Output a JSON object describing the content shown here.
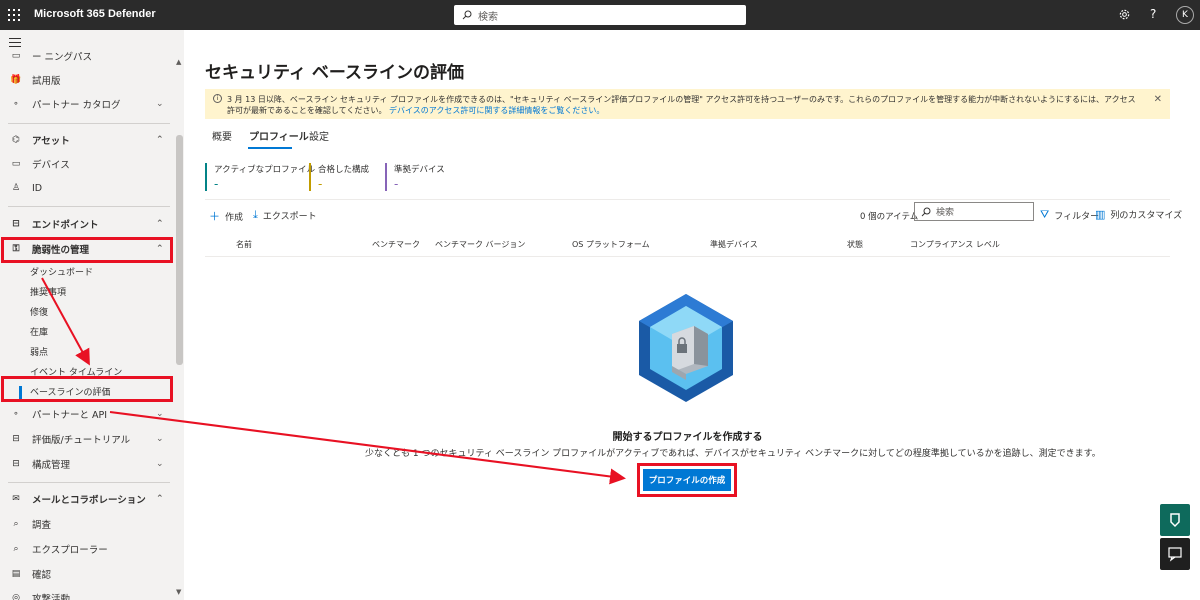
{
  "app": {
    "title": "Microsoft 365 Defender",
    "search_placeholder": "検索",
    "help": "?",
    "avatar": "K"
  },
  "sidebar": {
    "items": [
      {
        "label": "ー ニングパス",
        "icon": "learning-icon"
      },
      {
        "label": "試用版",
        "icon": "trial-icon"
      },
      {
        "label": "パートナー カタログ",
        "icon": "partner-catalog-icon"
      },
      {
        "label": "アセット",
        "icon": "assets-icon"
      },
      {
        "label": "デバイス",
        "icon": "device-icon"
      },
      {
        "label": "ID",
        "icon": "identity-icon"
      },
      {
        "label": "エンドポイント",
        "icon": "endpoints-icon"
      },
      {
        "label": "脆弱性の管理",
        "icon": "vulnerability-icon"
      },
      {
        "label": "ダッシュボード"
      },
      {
        "label": "推奨事項"
      },
      {
        "label": "修復"
      },
      {
        "label": "在庫"
      },
      {
        "label": "弱点"
      },
      {
        "label": "イベント タイムライン"
      },
      {
        "label": "ベースラインの評価"
      },
      {
        "label": "パートナーと API",
        "icon": "partner-api-icon"
      },
      {
        "label": "評価版/チュートリアル",
        "icon": "evaluation-icon"
      },
      {
        "label": "構成管理",
        "icon": "config-icon"
      },
      {
        "label": "メールとコラボレーション",
        "icon": "mail-icon"
      },
      {
        "label": "調査",
        "icon": "investigation-icon"
      },
      {
        "label": "エクスプローラー",
        "icon": "explorer-icon"
      },
      {
        "label": "確認",
        "icon": "review-icon"
      },
      {
        "label": "攻撃活動",
        "icon": "campaign-icon"
      }
    ]
  },
  "main": {
    "title": "セキュリティ ベースラインの評価",
    "banner": {
      "text": "3 月 13 日以降、ベースライン セキュリティ プロファイルを作成できるのは、\"セキュリティ ベースライン評価プロファイルの管理\" アクセス許可を持つユーザーのみです。これらのプロファイルを管理する能力が中断されないようにするには、アクセス許可が最新であることを確認してください。",
      "link": "デバイスのアクセス許可に関する詳細情報をご覧ください。"
    },
    "tabs": [
      "概要",
      "プロフィール",
      "設定"
    ],
    "stats": [
      {
        "label": "アクティブなプロファイル",
        "value": "-",
        "color": "#038387"
      },
      {
        "label": "合格した構成",
        "value": "-",
        "color": "#c19c00"
      },
      {
        "label": "準拠デバイス",
        "value": "-",
        "color": "#8764b8"
      }
    ],
    "toolbar": {
      "create": "作成",
      "export": "エクスポート",
      "count": "0 個のアイテム",
      "search_placeholder": "検索",
      "filter": "フィルター",
      "customize": "列のカスタマイズ"
    },
    "columns": [
      "名前",
      "ベンチマーク",
      "ベンチマーク バージョン",
      "OS プラットフォーム",
      "準拠デバイス",
      "状態",
      "コンプライアンス レベル"
    ],
    "empty": {
      "title": "開始するプロファイルを作成する",
      "description": "少なくとも 1 つのセキュリティ ベースライン プロファイルがアクティブであれば、デバイスがセキュリティ ベンチマークに対してどの程度準拠しているかを追跡し、測定できます。",
      "button": "プロファイルの作成"
    }
  },
  "colors": {
    "accent": "#0078d4",
    "annotation": "#e81123",
    "banner": "#fff4ce"
  }
}
